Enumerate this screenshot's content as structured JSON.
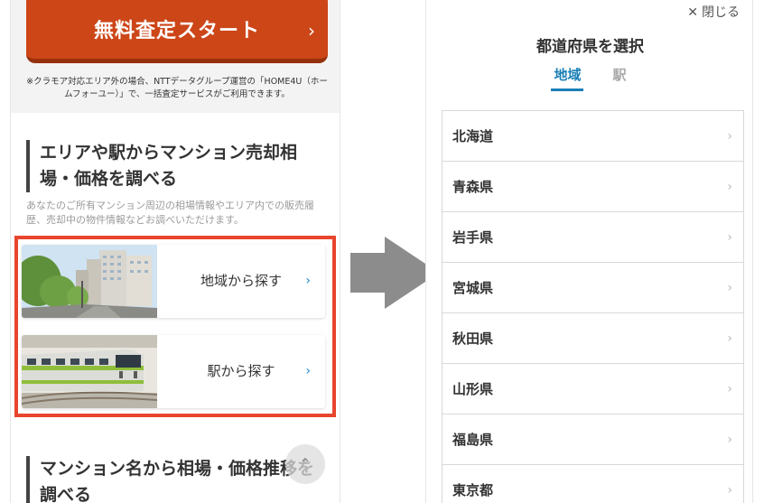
{
  "left": {
    "cta_label": "無料査定スタート",
    "cta_chevron": "›",
    "notice_text": "※クラモア対応エリア外の場合、NTTデータグループ運営の「HOME4U（ホームフォーユー）」で、一括査定サービスがご利用できます。",
    "section_heading": "エリアや駅からマンション売却相場・価格を調べる",
    "section_desc": "あなたのご所有マンション周辺の相場情報やエリア内での販売履歴、売却中の物件情報などお調べいただけます。",
    "cards": [
      {
        "label": "地域から探す",
        "chevron": "›"
      },
      {
        "label": "駅から探す",
        "chevron": "›"
      }
    ],
    "section2_heading": "マンション名から相場・価格推移を調べる",
    "scroll_top_icon": "⌃",
    "highlight_color": "#e8452d"
  },
  "arrow_color": "#8c8c8c",
  "right": {
    "close_icon": "✕",
    "close_label": "閉じる",
    "title": "都道府県を選択",
    "tabs": [
      {
        "label": "地域",
        "active": true
      },
      {
        "label": "駅",
        "active": false
      }
    ],
    "prefectures": [
      "北海道",
      "青森県",
      "岩手県",
      "宮城県",
      "秋田県",
      "山形県",
      "福島県",
      "東京都"
    ],
    "chevron": "›",
    "accent_color": "#1a7fb6"
  }
}
